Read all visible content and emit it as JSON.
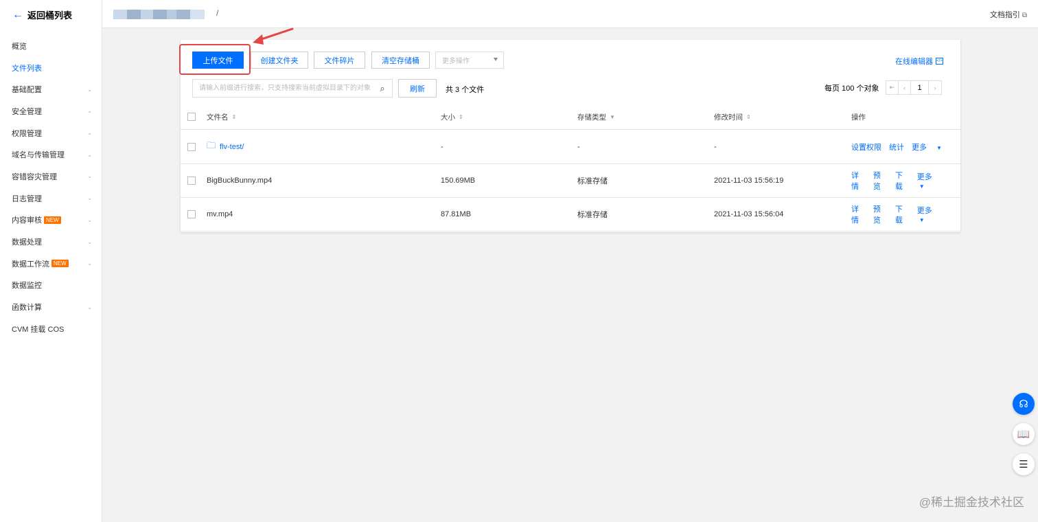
{
  "sidebar": {
    "back_label": "返回桶列表",
    "items": [
      {
        "label": "概览",
        "active": false,
        "chevron": false,
        "badge": ""
      },
      {
        "label": "文件列表",
        "active": true,
        "chevron": false,
        "badge": ""
      },
      {
        "label": "基础配置",
        "active": false,
        "chevron": true,
        "badge": ""
      },
      {
        "label": "安全管理",
        "active": false,
        "chevron": true,
        "badge": ""
      },
      {
        "label": "权限管理",
        "active": false,
        "chevron": true,
        "badge": ""
      },
      {
        "label": "域名与传输管理",
        "active": false,
        "chevron": true,
        "badge": ""
      },
      {
        "label": "容错容灾管理",
        "active": false,
        "chevron": true,
        "badge": ""
      },
      {
        "label": "日志管理",
        "active": false,
        "chevron": true,
        "badge": ""
      },
      {
        "label": "内容审核",
        "active": false,
        "chevron": true,
        "badge": "NEW"
      },
      {
        "label": "数据处理",
        "active": false,
        "chevron": true,
        "badge": ""
      },
      {
        "label": "数据工作流",
        "active": false,
        "chevron": true,
        "badge": "NEW"
      },
      {
        "label": "数据监控",
        "active": false,
        "chevron": false,
        "badge": ""
      },
      {
        "label": "函数计算",
        "active": false,
        "chevron": true,
        "badge": ""
      },
      {
        "label": "CVM 挂载 COS",
        "active": false,
        "chevron": false,
        "badge": ""
      }
    ]
  },
  "topbar": {
    "breadcrumb_sep": "/",
    "doc_link": "文档指引"
  },
  "toolbar": {
    "upload": "上传文件",
    "create_folder": "创建文件夹",
    "fragments": "文件碎片",
    "clear_bucket": "清空存储桶",
    "more_actions": "更多操作",
    "online_editor": "在线编辑器"
  },
  "search": {
    "placeholder": "请输入前缀进行搜索，只支持搜索当前虚拟目录下的对象",
    "refresh": "刷新",
    "total": "共 3 个文件"
  },
  "pagination": {
    "per_page": "每页 100 个对象",
    "page": "1"
  },
  "table": {
    "headers": {
      "name": "文件名",
      "size": "大小",
      "storage": "存储类型",
      "modified": "修改时间",
      "ops": "操作"
    },
    "rows": [
      {
        "name": "flv-test/",
        "size": "-",
        "storage": "-",
        "modified": "-",
        "ops": [
          "设置权限",
          "统计"
        ],
        "more": "更多"
      },
      {
        "name": "BigBuckBunny.mp4",
        "size": "150.69MB",
        "storage": "标准存储",
        "modified": "2021-11-03 15:56:19",
        "ops": [
          "详情",
          "预览",
          "下载"
        ],
        "more": "更多"
      },
      {
        "name": "mv.mp4",
        "size": "87.81MB",
        "storage": "标准存储",
        "modified": "2021-11-03 15:56:04",
        "ops": [
          "详情",
          "预览",
          "下载"
        ],
        "more": "更多"
      }
    ]
  },
  "watermark": "@稀土掘金技术社区",
  "colors": {
    "primary": "#006eff",
    "highlight": "#e54545",
    "badge": "#ff7200"
  }
}
